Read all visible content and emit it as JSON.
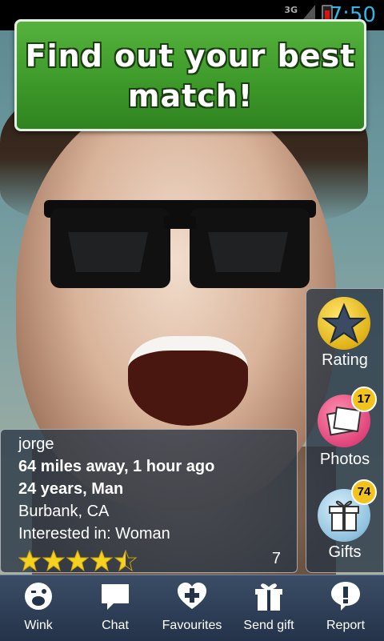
{
  "status_bar": {
    "network": "3G",
    "time": "7:50"
  },
  "banner": {
    "text_line1": "Find out your best",
    "text_line2": "match!"
  },
  "profile": {
    "name": "jorge",
    "distance": "64 miles away, 1 hour ago",
    "age_gender": "24 years, Man",
    "location": "Burbank, CA",
    "interested_in": "Interested in: Woman",
    "rating_stars": 4.5,
    "rating_count": "7"
  },
  "side_panel": {
    "rating_label": "Rating",
    "photos_label": "Photos",
    "photos_count": "17",
    "gifts_label": "Gifts",
    "gifts_count": "74"
  },
  "nav": {
    "items": [
      {
        "label": "Wink",
        "icon": "wink-face-icon"
      },
      {
        "label": "Chat",
        "icon": "chat-bubble-icon"
      },
      {
        "label": "Favourites",
        "icon": "heart-plus-icon"
      },
      {
        "label": "Send gift",
        "icon": "gift-icon"
      },
      {
        "label": "Report",
        "icon": "report-exclamation-icon"
      }
    ]
  },
  "colors": {
    "banner_green": "#3e9a2a",
    "time_blue": "#33b5e5",
    "star_gold": "#f4d21f",
    "badge_yellow": "#f2c31b"
  }
}
